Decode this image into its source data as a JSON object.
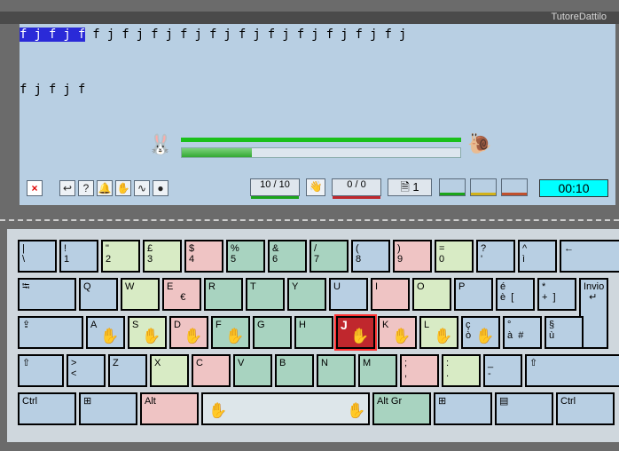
{
  "window": {
    "title": "TutoreDattilo"
  },
  "text": {
    "typed": "f j f j f",
    "remaining": " f j f j f j f j f j f j f j f j f j f j f j",
    "second_line": "f j f j f"
  },
  "progress": {
    "top_fraction": 1.0,
    "bottom_fraction": 0.25
  },
  "toolbar": {
    "close_icon": "×",
    "back_icon": "↩",
    "help_icon": "?",
    "bell_icon": "🔔",
    "hands_icon": "✋",
    "curve_icon": "∿",
    "drop_icon": "●",
    "counter_ok": "10 / 10",
    "counter_err": "0 / 0",
    "pages": "1",
    "timer": "00:10",
    "accent_green": "#1aa51a",
    "accent_red": "#c0272d",
    "accent_yellow": "#d2b21a",
    "accent_orange": "#c0502d"
  },
  "keyboard": {
    "rows": [
      [
        {
          "label": "|\n\\",
          "color": "#b8cfe3"
        },
        {
          "label": "!\n1",
          "color": "#b8cfe3"
        },
        {
          "label": "\"\n2",
          "color": "#d8ebc5"
        },
        {
          "label": "£\n3",
          "color": "#d8ebc5"
        },
        {
          "label": "$\n4",
          "color": "#efc4c4"
        },
        {
          "label": "%\n5",
          "color": "#a8d3c0"
        },
        {
          "label": "&\n6",
          "color": "#a8d3c0"
        },
        {
          "label": "/\n7",
          "color": "#a8d3c0"
        },
        {
          "label": "(\n8",
          "color": "#b8cfe3"
        },
        {
          "label": ")\n9",
          "color": "#efc4c4"
        },
        {
          "label": "=\n0",
          "color": "#d8ebc5"
        },
        {
          "label": "?\n'",
          "color": "#b8cfe3"
        },
        {
          "label": "^\nì",
          "color": "#b8cfe3"
        },
        {
          "label": "←",
          "color": "#b8cfe3"
        }
      ],
      [
        {
          "label": "⭾",
          "color": "#b8cfe3"
        },
        {
          "label": "Q",
          "color": "#b8cfe3"
        },
        {
          "label": "W",
          "color": "#d8ebc5"
        },
        {
          "label": "E\n     €",
          "color": "#efc4c4"
        },
        {
          "label": "R",
          "color": "#a8d3c0"
        },
        {
          "label": "T",
          "color": "#a8d3c0"
        },
        {
          "label": "Y",
          "color": "#a8d3c0"
        },
        {
          "label": "U",
          "color": "#b8cfe3"
        },
        {
          "label": "I",
          "color": "#efc4c4"
        },
        {
          "label": "O",
          "color": "#d8ebc5"
        },
        {
          "label": "P",
          "color": "#b8cfe3"
        },
        {
          "label": "é\nè  [",
          "color": "#b8cfe3"
        },
        {
          "label": "*\n+  ]",
          "color": "#b8cfe3"
        },
        {
          "label": "Invio\n  ↵",
          "color": "#b8cfe3"
        }
      ],
      [
        {
          "label": "⇪",
          "color": "#b8cfe3"
        },
        {
          "label": "A",
          "color": "#b8cfe3"
        },
        {
          "label": "S",
          "color": "#d8ebc5"
        },
        {
          "label": "D",
          "color": "#efc4c4"
        },
        {
          "label": "F",
          "color": "#a8d3c0"
        },
        {
          "label": "G",
          "color": "#a8d3c0"
        },
        {
          "label": "H",
          "color": "#a8d3c0"
        },
        {
          "label": "J",
          "color": "#c0272d"
        },
        {
          "label": "K",
          "color": "#efc4c4"
        },
        {
          "label": "L",
          "color": "#d8ebc5"
        },
        {
          "label": "ç\nò",
          "color": "#b8cfe3"
        },
        {
          "label": "°\nà  #",
          "color": "#b8cfe3"
        },
        {
          "label": "§\nù",
          "color": "#b8cfe3"
        }
      ],
      [
        {
          "label": "⇧",
          "color": "#b8cfe3"
        },
        {
          "label": ">\n<",
          "color": "#b8cfe3"
        },
        {
          "label": "Z",
          "color": "#b8cfe3"
        },
        {
          "label": "X",
          "color": "#d8ebc5"
        },
        {
          "label": "C",
          "color": "#efc4c4"
        },
        {
          "label": "V",
          "color": "#a8d3c0"
        },
        {
          "label": "B",
          "color": "#a8d3c0"
        },
        {
          "label": "N",
          "color": "#a8d3c0"
        },
        {
          "label": "M",
          "color": "#a8d3c0"
        },
        {
          "label": ";\n,",
          "color": "#efc4c4"
        },
        {
          "label": ":\n.",
          "color": "#d8ebc5"
        },
        {
          "label": "_\n-",
          "color": "#b8cfe3"
        },
        {
          "label": "⇧",
          "color": "#b8cfe3"
        }
      ],
      [
        {
          "label": "Ctrl",
          "color": "#b8cfe3"
        },
        {
          "label": "⊞",
          "color": "#b8cfe3"
        },
        {
          "label": "Alt",
          "color": "#efc4c4"
        },
        {
          "label": "",
          "color": "#dde6ea"
        },
        {
          "label": "Alt Gr",
          "color": "#a8d3c0"
        },
        {
          "label": "⊞",
          "color": "#b8cfe3"
        },
        {
          "label": "▤",
          "color": "#b8cfe3"
        },
        {
          "label": "Ctrl",
          "color": "#b8cfe3"
        }
      ]
    ],
    "home_keys": [
      "A",
      "S",
      "D",
      "F",
      "J",
      "K",
      "L",
      "ò"
    ],
    "hand_icon": "✋",
    "active_key": "J"
  }
}
